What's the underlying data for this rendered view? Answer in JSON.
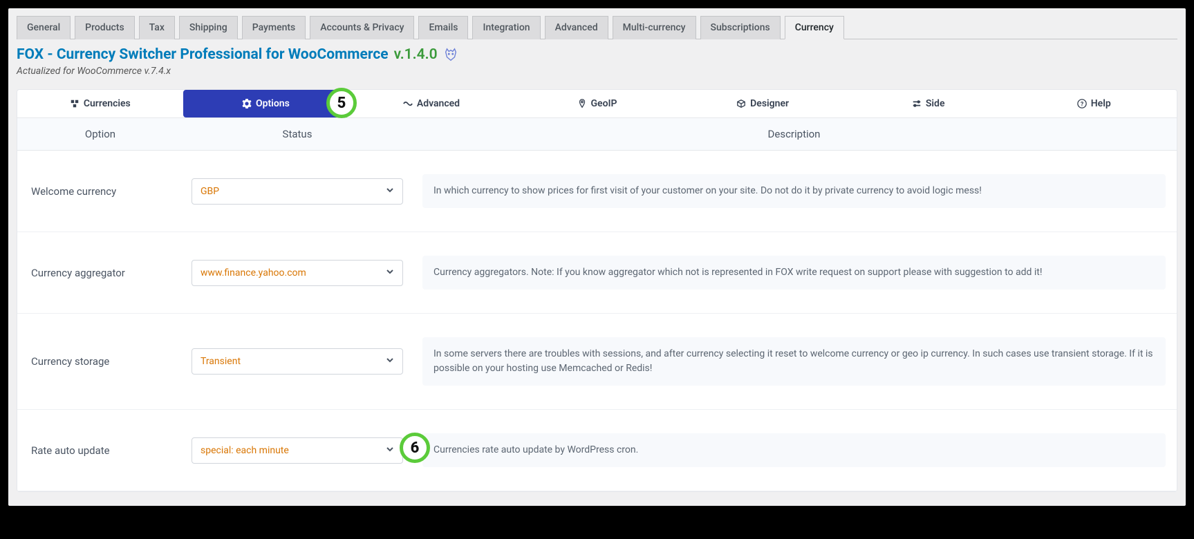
{
  "topTabs": {
    "general": "General",
    "products": "Products",
    "tax": "Tax",
    "shipping": "Shipping",
    "payments": "Payments",
    "accounts": "Accounts & Privacy",
    "emails": "Emails",
    "integration": "Integration",
    "advanced": "Advanced",
    "multiCurrency": "Multi-currency",
    "subscriptions": "Subscriptions",
    "currency": "Currency"
  },
  "plugin": {
    "name": "FOX - Currency Switcher Professional for WooCommerce",
    "version": "v.1.4.0",
    "subtitle": "Actualized for WooCommerce v.7.4.x"
  },
  "subTabs": {
    "currencies": "Currencies",
    "options": "Options",
    "advanced": "Advanced",
    "geoip": "GeoIP",
    "designer": "Designer",
    "side": "Side",
    "help": "Help"
  },
  "tableHeader": {
    "option": "Option",
    "status": "Status",
    "description": "Description"
  },
  "options": {
    "welcomeCurrency": {
      "label": "Welcome currency",
      "value": "GBP",
      "desc": "In which currency to show prices for first visit of your customer on your site. Do not do it by private currency to avoid logic mess!"
    },
    "aggregator": {
      "label": "Currency aggregator",
      "value": "www.finance.yahoo.com",
      "desc": "Currency aggregators. Note: If you know aggregator which not is represented in FOX write request on support please with suggestion to add it!"
    },
    "storage": {
      "label": "Currency storage",
      "value": "Transient",
      "desc": "In some servers there are troubles with sessions, and after currency selecting it reset to welcome currency or geo ip currency. In such cases use transient storage. If it is possible on your hosting use Memcached or Redis!"
    },
    "rateAuto": {
      "label": "Rate auto update",
      "value": "special: each minute",
      "desc": "Currencies rate auto update by WordPress cron."
    }
  },
  "markers": {
    "m5": "5",
    "m6": "6"
  }
}
